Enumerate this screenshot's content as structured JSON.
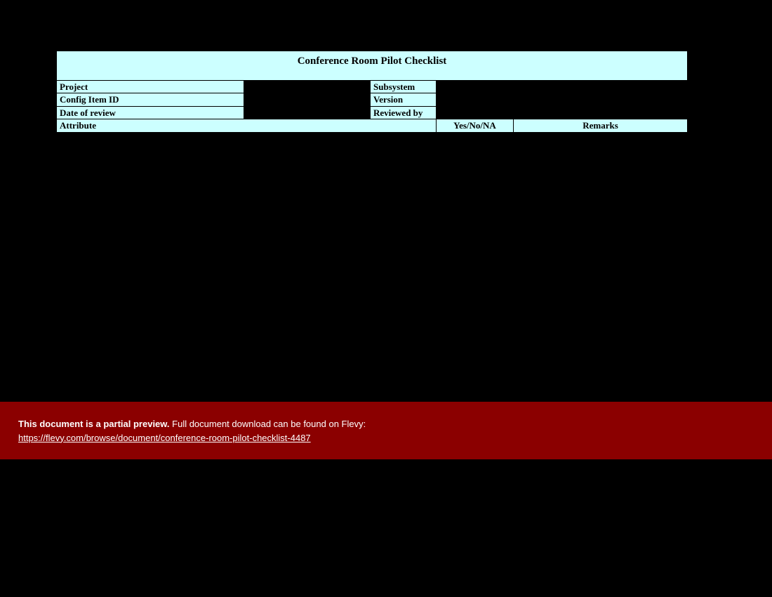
{
  "title": "Conference Room Pilot Checklist",
  "meta": {
    "project": "Project",
    "subsystem": "Subsystem",
    "config_item_id": "Config Item ID",
    "version": "Version",
    "date_of_review": "Date of review",
    "reviewed_by": "Reviewed by"
  },
  "headers": {
    "attribute": "Attribute",
    "yesno": "Yes/No/NA",
    "remarks": "Remarks"
  },
  "banner": {
    "bold": "This document is a partial preview.",
    "rest": "  Full document download can be found on Flevy:",
    "link": "https://flevy.com/browse/document/conference-room-pilot-checklist-4487"
  }
}
